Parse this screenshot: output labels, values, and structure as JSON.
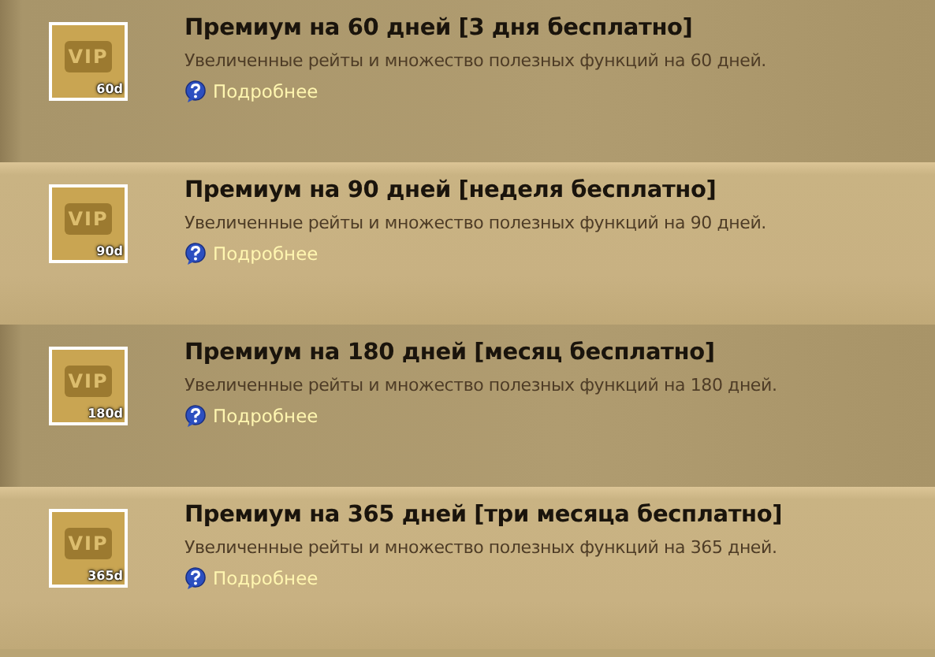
{
  "offers": [
    {
      "badge": "VIP",
      "duration": "60d",
      "title": "Премиум на 60 дней [3 дня бесплатно]",
      "description": "Увеличенные рейты и множество полезных функций на 60 дней.",
      "link": "Подробнее"
    },
    {
      "badge": "VIP",
      "duration": "90d",
      "title": "Премиум на 90 дней [неделя бесплатно]",
      "description": "Увеличенные рейты и множество полезных функций на 90 дней.",
      "link": "Подробнее"
    },
    {
      "badge": "VIP",
      "duration": "180d",
      "title": "Премиум на 180 дней [месяц бесплатно]",
      "description": "Увеличенные рейты и множество полезных функций на 180 дней.",
      "link": "Подробнее"
    },
    {
      "badge": "VIP",
      "duration": "365d",
      "title": "Премиум на 365 дней [три месяца бесплатно]",
      "description": "Увеличенные рейты и множество полезных функций на 365 дней.",
      "link": "Подробнее"
    }
  ]
}
